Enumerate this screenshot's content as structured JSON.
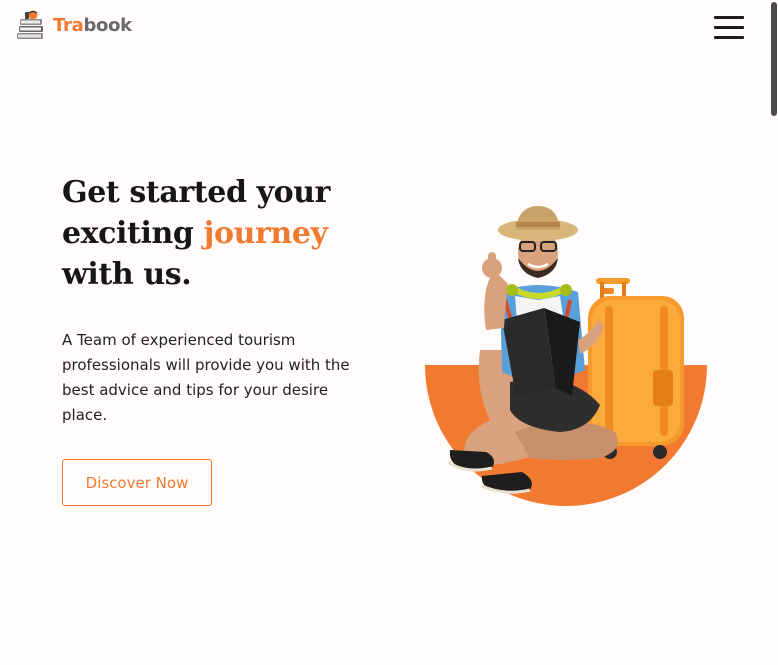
{
  "header": {
    "logo_part1": "Tra",
    "logo_part2": "book",
    "menu_icon": "hamburger-menu-icon"
  },
  "hero": {
    "title_line1": "Get started your",
    "title_line2_prefix": "exciting ",
    "title_accent": "journey",
    "title_line3": "with us.",
    "description": "A Team of experienced tourism professionals will provide you with the best advice and tips for your desire place.",
    "cta_label": "Discover Now"
  },
  "colors": {
    "accent": "#f27a30",
    "heading": "#161616",
    "background": "#fffcfb",
    "logo_grey": "#6a6a6a"
  }
}
